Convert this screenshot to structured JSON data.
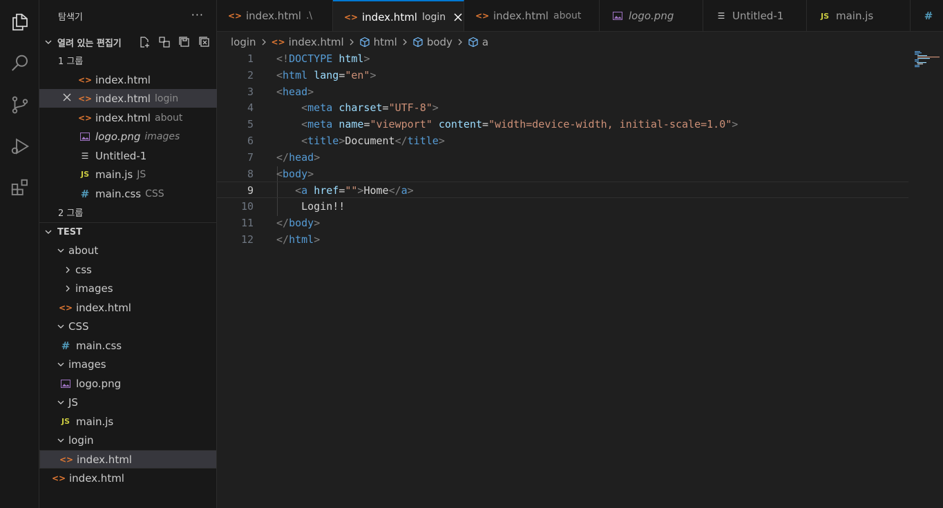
{
  "explorer": {
    "title": "탐색기",
    "more": "···",
    "open_editors": {
      "label": "열려 있는 편집기",
      "group1": "1 그룹",
      "group2": "2 그룹",
      "items": [
        {
          "name": "index.html",
          "desc": "",
          "icon": "html-icon"
        },
        {
          "name": "index.html",
          "desc": "login",
          "icon": "html-icon"
        },
        {
          "name": "index.html",
          "desc": "about",
          "icon": "html-icon"
        },
        {
          "name": "logo.png",
          "desc": "images",
          "icon": "image-icon"
        },
        {
          "name": "Untitled-1",
          "desc": "",
          "icon": "text-file-icon"
        },
        {
          "name": "main.js",
          "desc": "JS",
          "icon": "js-icon"
        },
        {
          "name": "main.css",
          "desc": "CSS",
          "icon": "css-icon"
        }
      ]
    },
    "workspace": {
      "label": "TEST",
      "tree": [
        {
          "name": "about",
          "type": "folder-open"
        },
        {
          "name": "css",
          "type": "folder-closed"
        },
        {
          "name": "images",
          "type": "folder-closed"
        },
        {
          "name": "index.html",
          "type": "html"
        },
        {
          "name": "CSS",
          "type": "folder-open"
        },
        {
          "name": "main.css",
          "type": "css"
        },
        {
          "name": "images",
          "type": "folder-open"
        },
        {
          "name": "logo.png",
          "type": "image"
        },
        {
          "name": "JS",
          "type": "folder-open"
        },
        {
          "name": "main.js",
          "type": "js"
        },
        {
          "name": "login",
          "type": "folder-open"
        },
        {
          "name": "index.html",
          "type": "html"
        },
        {
          "name": "index.html",
          "type": "html"
        }
      ]
    }
  },
  "tabs": [
    {
      "name": "index.html",
      "desc": ".\\",
      "icon": "html-icon"
    },
    {
      "name": "index.html",
      "desc": "login",
      "icon": "html-icon",
      "active": true
    },
    {
      "name": "index.html",
      "desc": "about",
      "icon": "html-icon"
    },
    {
      "name": "logo.png",
      "desc": "",
      "icon": "image-icon"
    },
    {
      "name": "Untitled-1",
      "desc": "",
      "icon": "text-file-icon"
    },
    {
      "name": "main.js",
      "desc": "",
      "icon": "js-icon"
    },
    {
      "name": "#",
      "desc": "",
      "icon": "css-icon"
    }
  ],
  "breadcrumb": [
    "login",
    "index.html",
    "html",
    "body",
    "a"
  ],
  "editor": {
    "current_line": 9,
    "lines": [
      {
        "n": "1",
        "tokens": [
          [
            "t-punc",
            "<!"
          ],
          [
            "t-tag",
            "DOCTYPE"
          ],
          [
            "t-text",
            " "
          ],
          [
            "t-attr",
            "html"
          ],
          [
            "t-punc",
            ">"
          ]
        ]
      },
      {
        "n": "2",
        "tokens": [
          [
            "t-punc",
            "<"
          ],
          [
            "t-tag",
            "html"
          ],
          [
            "t-text",
            " "
          ],
          [
            "t-attr",
            "lang"
          ],
          [
            "t-text",
            "="
          ],
          [
            "t-str",
            "\"en\""
          ],
          [
            "t-punc",
            ">"
          ]
        ]
      },
      {
        "n": "3",
        "tokens": [
          [
            "t-punc",
            "<"
          ],
          [
            "t-tag",
            "head"
          ],
          [
            "t-punc",
            ">"
          ]
        ]
      },
      {
        "n": "4",
        "tokens": [
          [
            "t-text",
            "    "
          ],
          [
            "t-punc",
            "<"
          ],
          [
            "t-tag",
            "meta"
          ],
          [
            "t-text",
            " "
          ],
          [
            "t-attr",
            "charset"
          ],
          [
            "t-text",
            "="
          ],
          [
            "t-str",
            "\"UTF-8\""
          ],
          [
            "t-punc",
            ">"
          ]
        ]
      },
      {
        "n": "5",
        "tokens": [
          [
            "t-text",
            "    "
          ],
          [
            "t-punc",
            "<"
          ],
          [
            "t-tag",
            "meta"
          ],
          [
            "t-text",
            " "
          ],
          [
            "t-attr",
            "name"
          ],
          [
            "t-text",
            "="
          ],
          [
            "t-str",
            "\"viewport\""
          ],
          [
            "t-text",
            " "
          ],
          [
            "t-attr",
            "content"
          ],
          [
            "t-text",
            "="
          ],
          [
            "t-str",
            "\"width=device-width, initial-scale=1.0\""
          ],
          [
            "t-punc",
            ">"
          ]
        ]
      },
      {
        "n": "6",
        "tokens": [
          [
            "t-text",
            "    "
          ],
          [
            "t-punc",
            "<"
          ],
          [
            "t-tag",
            "title"
          ],
          [
            "t-punc",
            ">"
          ],
          [
            "t-text",
            "Document"
          ],
          [
            "t-punc",
            "</"
          ],
          [
            "t-tag",
            "title"
          ],
          [
            "t-punc",
            ">"
          ]
        ]
      },
      {
        "n": "7",
        "tokens": [
          [
            "t-punc",
            "</"
          ],
          [
            "t-tag",
            "head"
          ],
          [
            "t-punc",
            ">"
          ]
        ]
      },
      {
        "n": "8",
        "tokens": [
          [
            "t-punc",
            "<"
          ],
          [
            "t-tag",
            "body"
          ],
          [
            "t-punc",
            ">"
          ]
        ]
      },
      {
        "n": "9",
        "tokens": [
          [
            "t-text",
            "   "
          ],
          [
            "t-punc",
            "<"
          ],
          [
            "t-tag",
            "a"
          ],
          [
            "t-text",
            " "
          ],
          [
            "t-attr",
            "href"
          ],
          [
            "t-text",
            "="
          ],
          [
            "t-str",
            "\"\""
          ],
          [
            "t-punc",
            ">"
          ],
          [
            "t-text",
            "Home"
          ],
          [
            "t-punc",
            "</"
          ],
          [
            "t-tag",
            "a"
          ],
          [
            "t-punc",
            ">"
          ]
        ]
      },
      {
        "n": "10",
        "tokens": [
          [
            "t-text",
            "    Login!!"
          ]
        ]
      },
      {
        "n": "11",
        "tokens": [
          [
            "t-punc",
            "</"
          ],
          [
            "t-tag",
            "body"
          ],
          [
            "t-punc",
            ">"
          ]
        ]
      },
      {
        "n": "12",
        "tokens": [
          [
            "t-punc",
            "</"
          ],
          [
            "t-tag",
            "html"
          ],
          [
            "t-punc",
            ">"
          ]
        ]
      }
    ]
  },
  "colors": {
    "accent": "#0078d4",
    "html": "#e37933",
    "js": "#cbcb41",
    "css": "#519aba",
    "image": "#a074c4"
  }
}
